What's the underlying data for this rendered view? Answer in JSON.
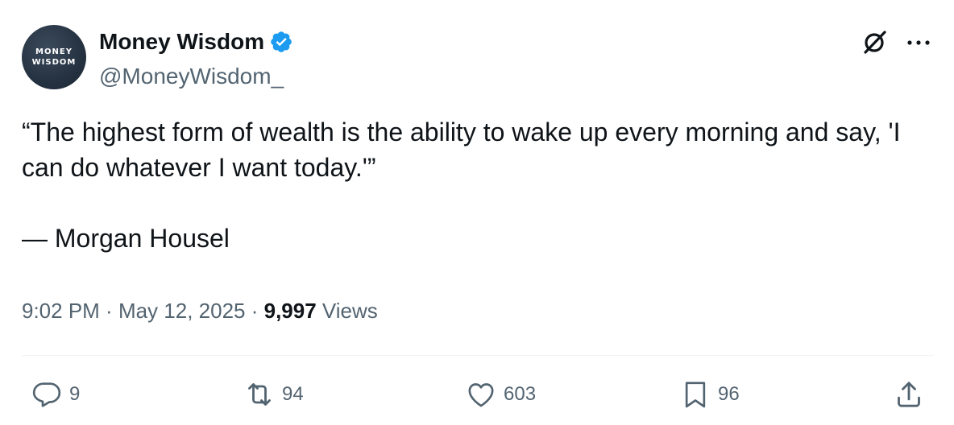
{
  "author": {
    "avatar_line1": "MONEY",
    "avatar_line2": "WISDOM",
    "name": "Money Wisdom",
    "handle": "@MoneyWisdom_",
    "verified_icon": "verified-badge-icon",
    "verified_color": "#1d9bf0"
  },
  "header_icons": [
    "grok-icon",
    "more-options-icon"
  ],
  "tweet": {
    "line1": "“The highest form of wealth is the ability to wake up every morning and say, 'I can do whatever I want today.'”",
    "line2": "— Morgan Housel"
  },
  "meta": {
    "time": "9:02 PM",
    "sep1": " · ",
    "date": "May 12, 2025",
    "sep2": " · ",
    "views_count": "9,997",
    "views_label": " Views"
  },
  "actions": {
    "reply": {
      "icon": "reply-icon",
      "count": "9"
    },
    "retweet": {
      "icon": "retweet-icon",
      "count": "94"
    },
    "like": {
      "icon": "heart-icon",
      "count": "603"
    },
    "bookmark": {
      "icon": "bookmark-icon",
      "count": "96"
    },
    "share": {
      "icon": "share-icon"
    }
  },
  "colors": {
    "text": "#0f1419",
    "secondary": "#536471",
    "divider": "#eff3f4",
    "accent": "#1d9bf0"
  }
}
